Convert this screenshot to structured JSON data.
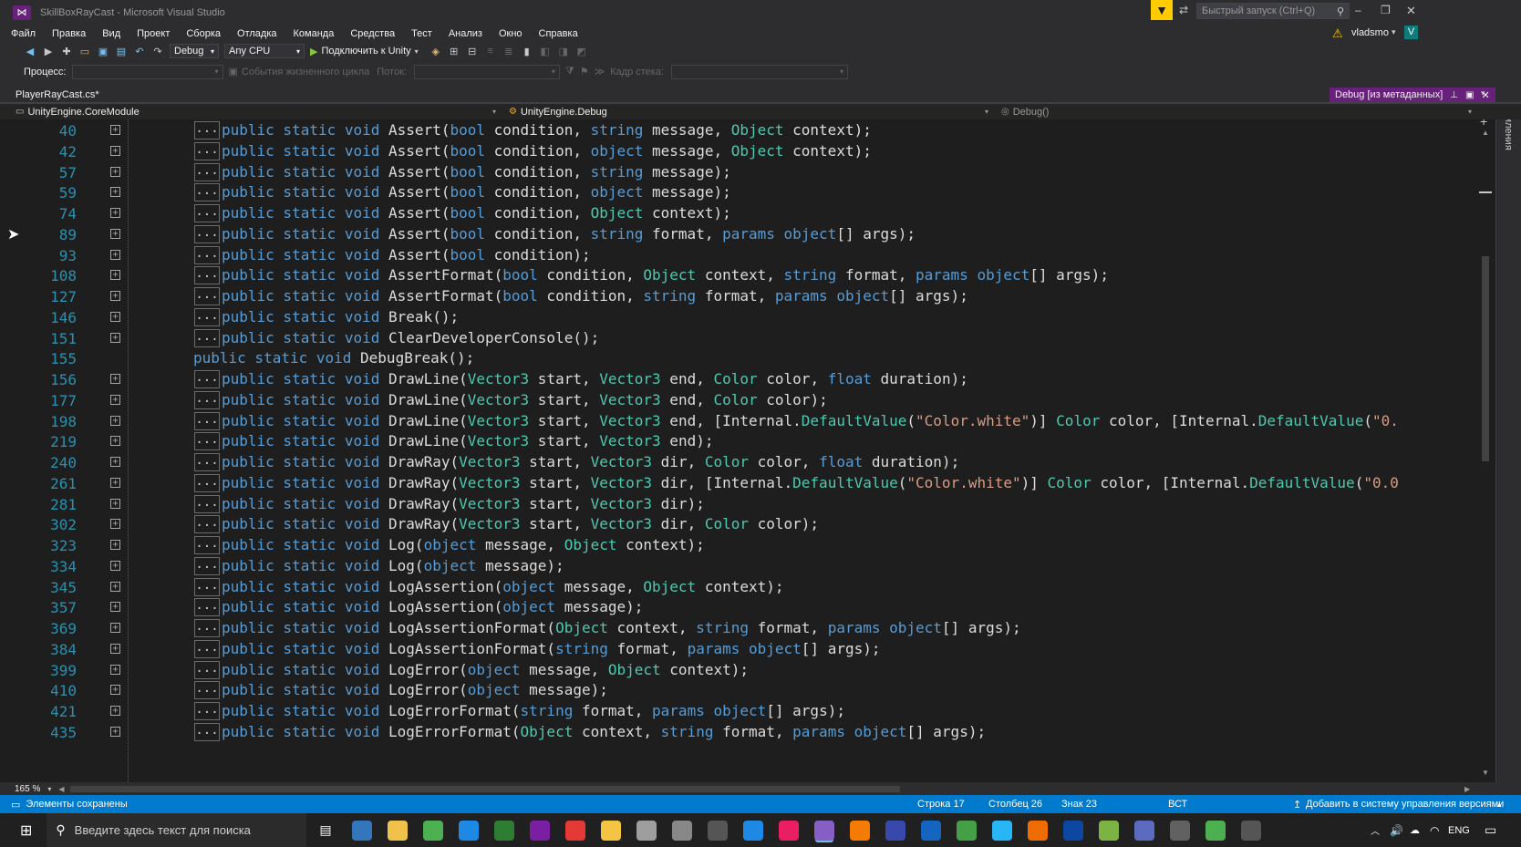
{
  "window": {
    "title": "SkillBoxRayCast - Microsoft Visual Studio",
    "quick_launch_placeholder": "Быстрый запуск (Ctrl+Q)",
    "user": "vladsmo",
    "user_initial": "V"
  },
  "menu": [
    "Файл",
    "Правка",
    "Вид",
    "Проект",
    "Сборка",
    "Отладка",
    "Команда",
    "Средства",
    "Тест",
    "Анализ",
    "Окно",
    "Справка"
  ],
  "toolbar": {
    "config": "Debug",
    "platform": "Any CPU",
    "attach": "Подключить к Unity"
  },
  "debug_toolbar": {
    "process_label": "Процесс:",
    "lifecycle": "События жизненного цикла",
    "thread": "Поток:",
    "stack_frame": "Кадр стека:"
  },
  "tabs": {
    "active": "PlayerRayCast.cs*",
    "metadata": "Debug [из метаданных]"
  },
  "navbar": {
    "module": "UnityEngine.CoreModule",
    "class": "UnityEngine.Debug",
    "member": "Debug()"
  },
  "side_panel": "Уведомления",
  "code": {
    "lines": [
      {
        "n": "40",
        "folded": true,
        "tokens": [
          [
            "kw",
            "public static void "
          ],
          [
            "pl",
            "Assert("
          ],
          [
            "kw",
            "bool"
          ],
          [
            "pl",
            " condition, "
          ],
          [
            "kw",
            "string"
          ],
          [
            "pl",
            " message, "
          ],
          [
            "ty",
            "Object"
          ],
          [
            "pl",
            " context);"
          ]
        ]
      },
      {
        "n": "42",
        "folded": true,
        "tokens": [
          [
            "kw",
            "public static void "
          ],
          [
            "pl",
            "Assert("
          ],
          [
            "kw",
            "bool"
          ],
          [
            "pl",
            " condition, "
          ],
          [
            "kw",
            "object"
          ],
          [
            "pl",
            " message, "
          ],
          [
            "ty",
            "Object"
          ],
          [
            "pl",
            " context);"
          ]
        ]
      },
      {
        "n": "57",
        "folded": true,
        "tokens": [
          [
            "kw",
            "public static void "
          ],
          [
            "pl",
            "Assert("
          ],
          [
            "kw",
            "bool"
          ],
          [
            "pl",
            " condition, "
          ],
          [
            "kw",
            "string"
          ],
          [
            "pl",
            " message);"
          ]
        ]
      },
      {
        "n": "59",
        "folded": true,
        "tokens": [
          [
            "kw",
            "public static void "
          ],
          [
            "pl",
            "Assert("
          ],
          [
            "kw",
            "bool"
          ],
          [
            "pl",
            " condition, "
          ],
          [
            "kw",
            "object"
          ],
          [
            "pl",
            " message);"
          ]
        ]
      },
      {
        "n": "74",
        "folded": true,
        "tokens": [
          [
            "kw",
            "public static void "
          ],
          [
            "pl",
            "Assert("
          ],
          [
            "kw",
            "bool"
          ],
          [
            "pl",
            " condition, "
          ],
          [
            "ty",
            "Object"
          ],
          [
            "pl",
            " context);"
          ]
        ]
      },
      {
        "n": "89",
        "folded": true,
        "tokens": [
          [
            "kw",
            "public static void "
          ],
          [
            "pl",
            "Assert("
          ],
          [
            "kw",
            "bool"
          ],
          [
            "pl",
            " condition, "
          ],
          [
            "kw",
            "string"
          ],
          [
            "pl",
            " format, "
          ],
          [
            "kw",
            "params object"
          ],
          [
            "pl",
            "[] args);"
          ]
        ]
      },
      {
        "n": "93",
        "folded": true,
        "tokens": [
          [
            "kw",
            "public static void "
          ],
          [
            "pl",
            "Assert("
          ],
          [
            "kw",
            "bool"
          ],
          [
            "pl",
            " condition);"
          ]
        ]
      },
      {
        "n": "108",
        "folded": true,
        "tokens": [
          [
            "kw",
            "public static void "
          ],
          [
            "pl",
            "AssertFormat("
          ],
          [
            "kw",
            "bool"
          ],
          [
            "pl",
            " condition, "
          ],
          [
            "ty",
            "Object"
          ],
          [
            "pl",
            " context, "
          ],
          [
            "kw",
            "string"
          ],
          [
            "pl",
            " format, "
          ],
          [
            "kw",
            "params object"
          ],
          [
            "pl",
            "[] args);"
          ]
        ]
      },
      {
        "n": "127",
        "folded": true,
        "tokens": [
          [
            "kw",
            "public static void "
          ],
          [
            "pl",
            "AssertFormat("
          ],
          [
            "kw",
            "bool"
          ],
          [
            "pl",
            " condition, "
          ],
          [
            "kw",
            "string"
          ],
          [
            "pl",
            " format, "
          ],
          [
            "kw",
            "params object"
          ],
          [
            "pl",
            "[] args);"
          ]
        ]
      },
      {
        "n": "146",
        "folded": true,
        "tokens": [
          [
            "kw",
            "public static void "
          ],
          [
            "pl",
            "Break();"
          ]
        ]
      },
      {
        "n": "151",
        "folded": true,
        "tokens": [
          [
            "kw",
            "public static void "
          ],
          [
            "pl",
            "ClearDeveloperConsole();"
          ]
        ]
      },
      {
        "n": "155",
        "folded": false,
        "tokens": [
          [
            "kw",
            "public static void "
          ],
          [
            "pl",
            "DebugBreak();"
          ]
        ]
      },
      {
        "n": "156",
        "folded": true,
        "tokens": [
          [
            "kw",
            "public static void "
          ],
          [
            "pl",
            "DrawLine("
          ],
          [
            "ty",
            "Vector3"
          ],
          [
            "pl",
            " start, "
          ],
          [
            "ty",
            "Vector3"
          ],
          [
            "pl",
            " end, "
          ],
          [
            "ty",
            "Color"
          ],
          [
            "pl",
            " color, "
          ],
          [
            "kw",
            "float"
          ],
          [
            "pl",
            " duration);"
          ]
        ]
      },
      {
        "n": "177",
        "folded": true,
        "tokens": [
          [
            "kw",
            "public static void "
          ],
          [
            "pl",
            "DrawLine("
          ],
          [
            "ty",
            "Vector3"
          ],
          [
            "pl",
            " start, "
          ],
          [
            "ty",
            "Vector3"
          ],
          [
            "pl",
            " end, "
          ],
          [
            "ty",
            "Color"
          ],
          [
            "pl",
            " color);"
          ]
        ]
      },
      {
        "n": "198",
        "folded": true,
        "tokens": [
          [
            "kw",
            "public static void "
          ],
          [
            "pl",
            "DrawLine("
          ],
          [
            "ty",
            "Vector3"
          ],
          [
            "pl",
            " start, "
          ],
          [
            "ty",
            "Vector3"
          ],
          [
            "pl",
            " end, [Internal."
          ],
          [
            "ty",
            "DefaultValue"
          ],
          [
            "pl",
            "("
          ],
          [
            "st",
            "\"Color.white\""
          ],
          [
            "pl",
            ")] "
          ],
          [
            "ty",
            "Color"
          ],
          [
            "pl",
            " color, [Internal."
          ],
          [
            "ty",
            "DefaultValue"
          ],
          [
            "pl",
            "("
          ],
          [
            "st",
            "\"0."
          ]
        ]
      },
      {
        "n": "219",
        "folded": true,
        "tokens": [
          [
            "kw",
            "public static void "
          ],
          [
            "pl",
            "DrawLine("
          ],
          [
            "ty",
            "Vector3"
          ],
          [
            "pl",
            " start, "
          ],
          [
            "ty",
            "Vector3"
          ],
          [
            "pl",
            " end);"
          ]
        ]
      },
      {
        "n": "240",
        "folded": true,
        "tokens": [
          [
            "kw",
            "public static void "
          ],
          [
            "pl",
            "DrawRay("
          ],
          [
            "ty",
            "Vector3"
          ],
          [
            "pl",
            " start, "
          ],
          [
            "ty",
            "Vector3"
          ],
          [
            "pl",
            " dir, "
          ],
          [
            "ty",
            "Color"
          ],
          [
            "pl",
            " color, "
          ],
          [
            "kw",
            "float"
          ],
          [
            "pl",
            " duration);"
          ]
        ]
      },
      {
        "n": "261",
        "folded": true,
        "tokens": [
          [
            "kw",
            "public static void "
          ],
          [
            "pl",
            "DrawRay("
          ],
          [
            "ty",
            "Vector3"
          ],
          [
            "pl",
            " start, "
          ],
          [
            "ty",
            "Vector3"
          ],
          [
            "pl",
            " dir, [Internal."
          ],
          [
            "ty",
            "DefaultValue"
          ],
          [
            "pl",
            "("
          ],
          [
            "st",
            "\"Color.white\""
          ],
          [
            "pl",
            ")] "
          ],
          [
            "ty",
            "Color"
          ],
          [
            "pl",
            " color, [Internal."
          ],
          [
            "ty",
            "DefaultValue"
          ],
          [
            "pl",
            "("
          ],
          [
            "st",
            "\"0.0"
          ]
        ]
      },
      {
        "n": "281",
        "folded": true,
        "tokens": [
          [
            "kw",
            "public static void "
          ],
          [
            "pl",
            "DrawRay("
          ],
          [
            "ty",
            "Vector3"
          ],
          [
            "pl",
            " start, "
          ],
          [
            "ty",
            "Vector3"
          ],
          [
            "pl",
            " dir);"
          ]
        ]
      },
      {
        "n": "302",
        "folded": true,
        "tokens": [
          [
            "kw",
            "public static void "
          ],
          [
            "pl",
            "DrawRay("
          ],
          [
            "ty",
            "Vector3"
          ],
          [
            "pl",
            " start, "
          ],
          [
            "ty",
            "Vector3"
          ],
          [
            "pl",
            " dir, "
          ],
          [
            "ty",
            "Color"
          ],
          [
            "pl",
            " color);"
          ]
        ]
      },
      {
        "n": "323",
        "folded": true,
        "tokens": [
          [
            "kw",
            "public static void "
          ],
          [
            "pl",
            "Log("
          ],
          [
            "kw",
            "object"
          ],
          [
            "pl",
            " message, "
          ],
          [
            "ty",
            "Object"
          ],
          [
            "pl",
            " context);"
          ]
        ]
      },
      {
        "n": "334",
        "folded": true,
        "tokens": [
          [
            "kw",
            "public static void "
          ],
          [
            "pl",
            "Log("
          ],
          [
            "kw",
            "object"
          ],
          [
            "pl",
            " message);"
          ]
        ]
      },
      {
        "n": "345",
        "folded": true,
        "tokens": [
          [
            "kw",
            "public static void "
          ],
          [
            "pl",
            "LogAssertion("
          ],
          [
            "kw",
            "object"
          ],
          [
            "pl",
            " message, "
          ],
          [
            "ty",
            "Object"
          ],
          [
            "pl",
            " context);"
          ]
        ]
      },
      {
        "n": "357",
        "folded": true,
        "tokens": [
          [
            "kw",
            "public static void "
          ],
          [
            "pl",
            "LogAssertion("
          ],
          [
            "kw",
            "object"
          ],
          [
            "pl",
            " message);"
          ]
        ]
      },
      {
        "n": "369",
        "folded": true,
        "tokens": [
          [
            "kw",
            "public static void "
          ],
          [
            "pl",
            "LogAssertionFormat("
          ],
          [
            "ty",
            "Object"
          ],
          [
            "pl",
            " context, "
          ],
          [
            "kw",
            "string"
          ],
          [
            "pl",
            " format, "
          ],
          [
            "kw",
            "params object"
          ],
          [
            "pl",
            "[] args);"
          ]
        ]
      },
      {
        "n": "384",
        "folded": true,
        "tokens": [
          [
            "kw",
            "public static void "
          ],
          [
            "pl",
            "LogAssertionFormat("
          ],
          [
            "kw",
            "string"
          ],
          [
            "pl",
            " format, "
          ],
          [
            "kw",
            "params object"
          ],
          [
            "pl",
            "[] args);"
          ]
        ]
      },
      {
        "n": "399",
        "folded": true,
        "tokens": [
          [
            "kw",
            "public static void "
          ],
          [
            "pl",
            "LogError("
          ],
          [
            "kw",
            "object"
          ],
          [
            "pl",
            " message, "
          ],
          [
            "ty",
            "Object"
          ],
          [
            "pl",
            " context);"
          ]
        ]
      },
      {
        "n": "410",
        "folded": true,
        "tokens": [
          [
            "kw",
            "public static void "
          ],
          [
            "pl",
            "LogError("
          ],
          [
            "kw",
            "object"
          ],
          [
            "pl",
            " message);"
          ]
        ]
      },
      {
        "n": "421",
        "folded": true,
        "tokens": [
          [
            "kw",
            "public static void "
          ],
          [
            "pl",
            "LogErrorFormat("
          ],
          [
            "kw",
            "string"
          ],
          [
            "pl",
            " format, "
          ],
          [
            "kw",
            "params object"
          ],
          [
            "pl",
            "[] args);"
          ]
        ]
      },
      {
        "n": "435",
        "folded": true,
        "tokens": [
          [
            "kw",
            "public static void "
          ],
          [
            "pl",
            "LogErrorFormat("
          ],
          [
            "ty",
            "Object"
          ],
          [
            "pl",
            " context, "
          ],
          [
            "kw",
            "string"
          ],
          [
            "pl",
            " format, "
          ],
          [
            "kw",
            "params object"
          ],
          [
            "pl",
            "[] args);"
          ]
        ]
      }
    ]
  },
  "zoom": "165 %",
  "status": {
    "message": "Элементы сохранены",
    "line": "Строка 17",
    "column": "Столбец 26",
    "char": "Знак 23",
    "mode": "ВСТ",
    "vcs": "Добавить в систему управления версиями"
  },
  "taskbar": {
    "search_placeholder": "Введите здесь текст для поиска",
    "lang": "ENG",
    "apps": [
      {
        "name": "edge-icon",
        "color": "#3277bc"
      },
      {
        "name": "explorer-icon",
        "color": "#f0c24b"
      },
      {
        "name": "chrome-icon",
        "color": "#4caf50"
      },
      {
        "name": "maps-icon",
        "color": "#1e88e5"
      },
      {
        "name": "excel-like-icon",
        "color": "#2e7d32"
      },
      {
        "name": "rider-icon",
        "color": "#7a1fa2"
      },
      {
        "name": "opera-icon",
        "color": "#e53935"
      },
      {
        "name": "folder-icon",
        "color": "#f4c542"
      },
      {
        "name": "bird-icon",
        "color": "#9e9e9e"
      },
      {
        "name": "twitch-icon",
        "color": "#888888"
      },
      {
        "name": "vs-code-dim-icon",
        "color": "#555555"
      },
      {
        "name": "skype-icon",
        "color": "#1e88e5"
      },
      {
        "name": "slack-icon",
        "color": "#e91e63"
      },
      {
        "name": "visual-studio-icon",
        "color": "#865fc5"
      },
      {
        "name": "sublime-icon",
        "color": "#f57c00"
      },
      {
        "name": "disk-icon",
        "color": "#3949ab"
      },
      {
        "name": "word-icon",
        "color": "#1565c0"
      },
      {
        "name": "whatsapp-icon",
        "color": "#43a047"
      },
      {
        "name": "telegram-icon",
        "color": "#29b6f6"
      },
      {
        "name": "blender-icon",
        "color": "#ef6c00"
      },
      {
        "name": "vpn-icon",
        "color": "#0d47a1"
      },
      {
        "name": "android-icon",
        "color": "#7cb342"
      },
      {
        "name": "teams-icon",
        "color": "#5c6bc0"
      },
      {
        "name": "unity-icon",
        "color": "#616161"
      },
      {
        "name": "chrome-user-icon",
        "color": "#4caf50"
      },
      {
        "name": "vs-icon",
        "color": "#555555"
      }
    ]
  }
}
